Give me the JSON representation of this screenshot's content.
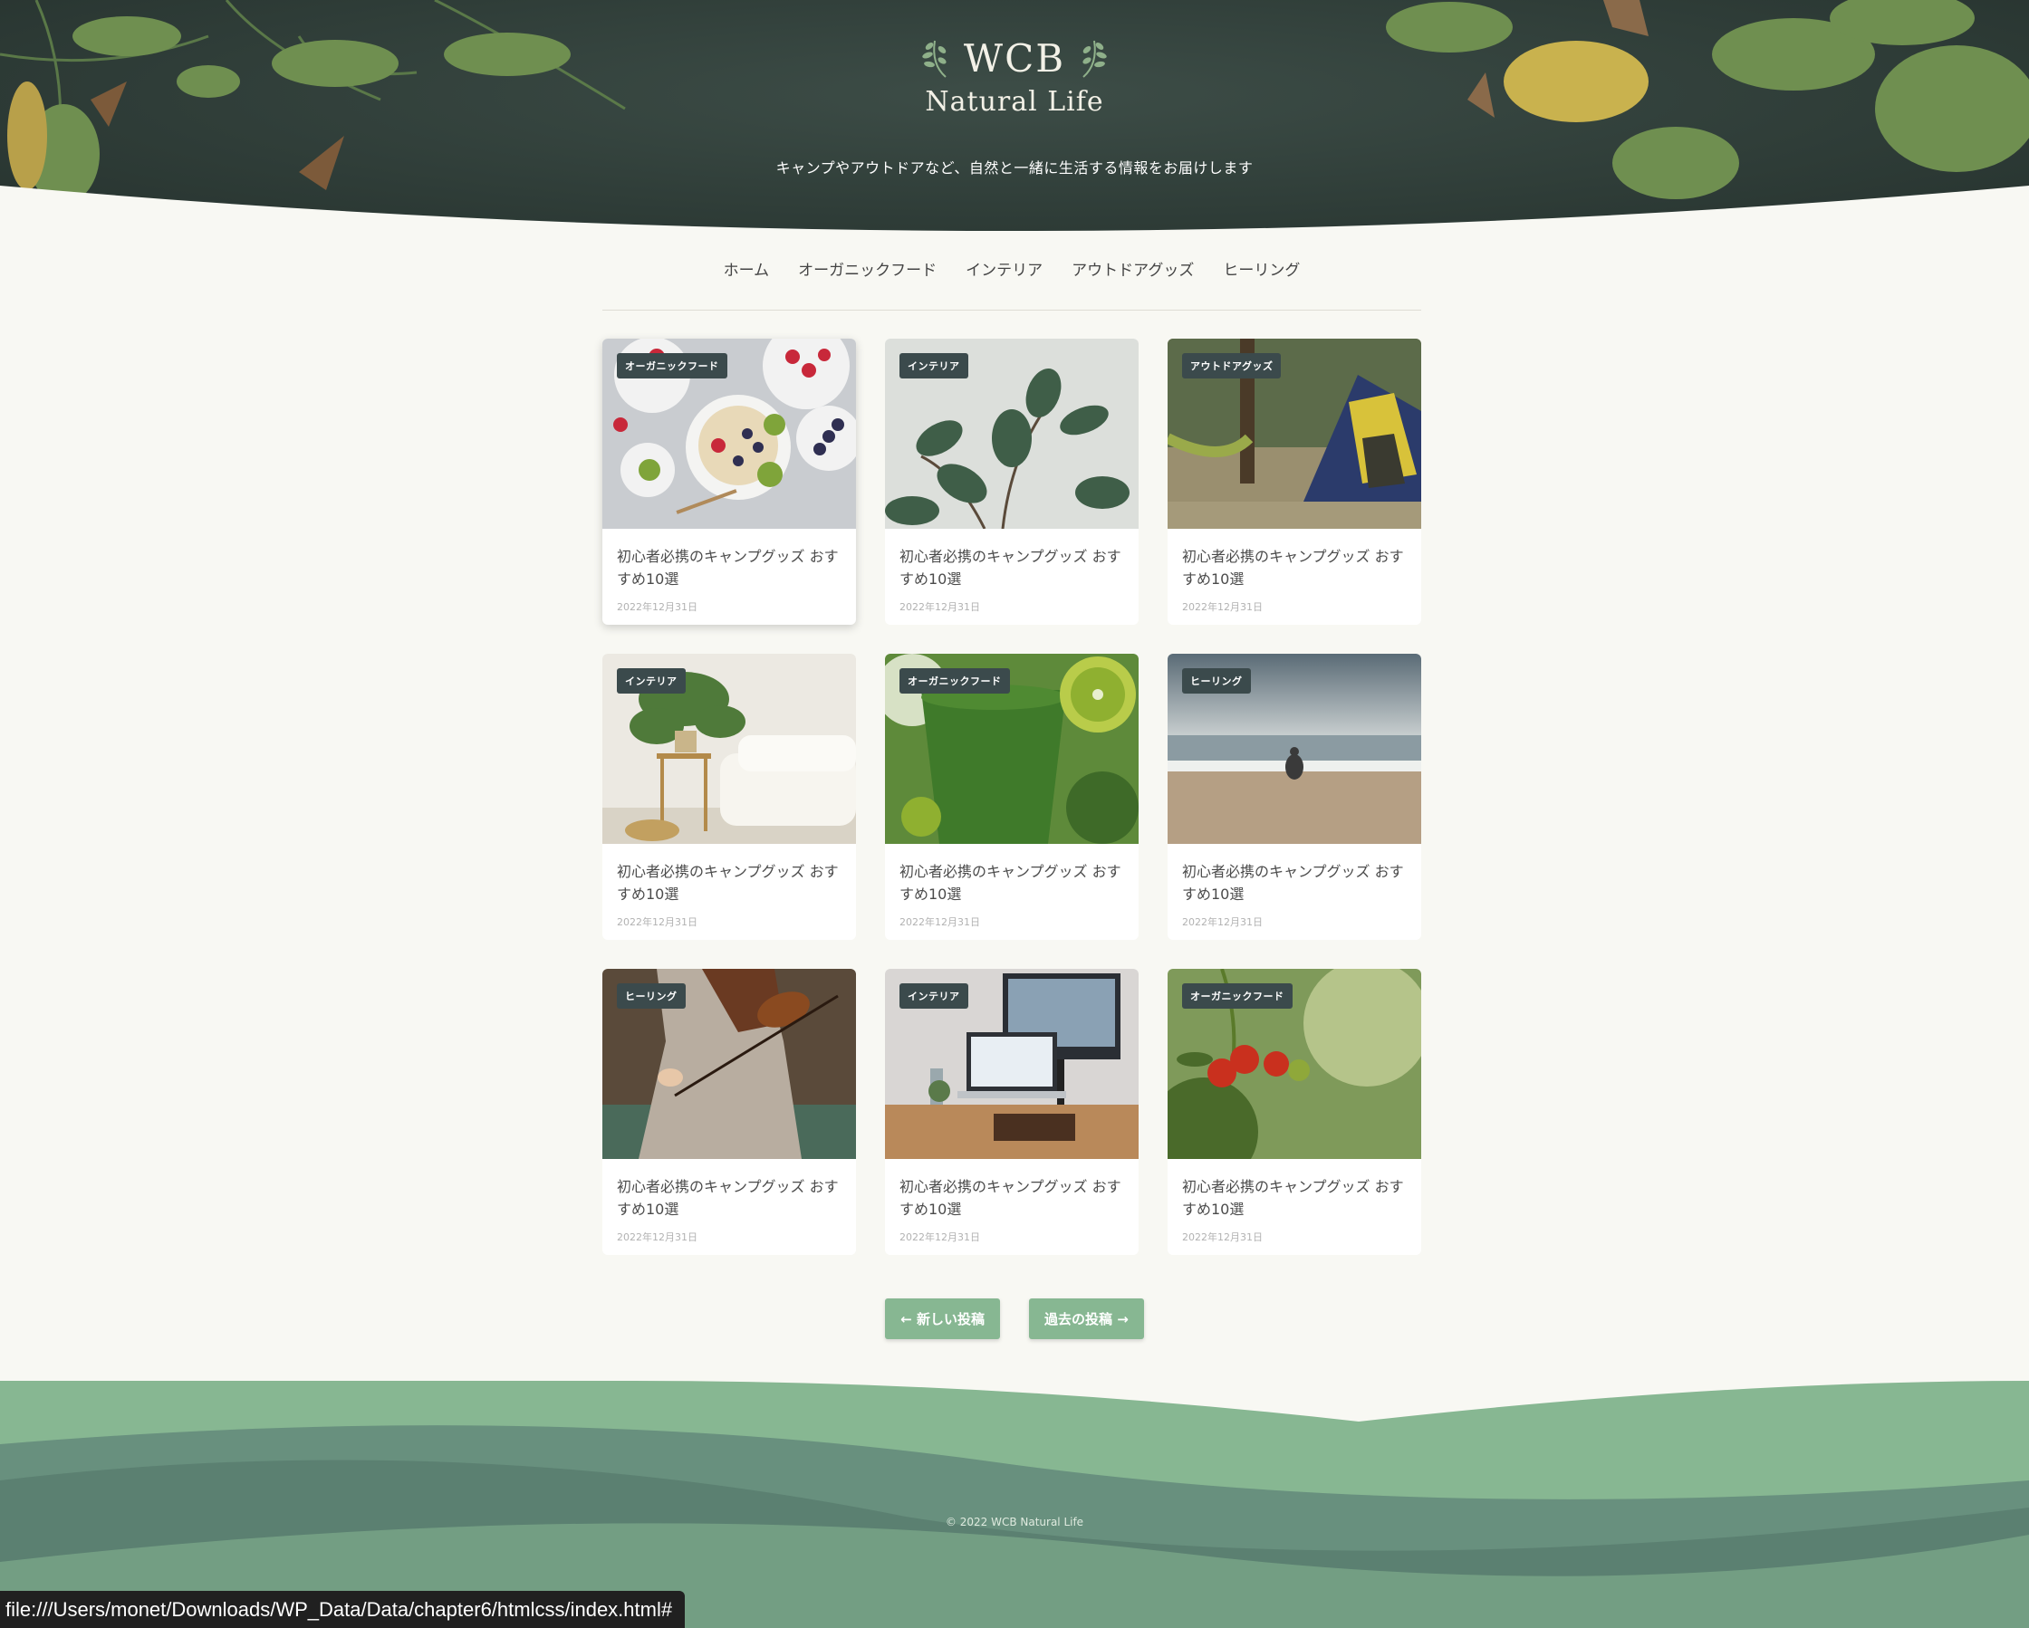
{
  "site": {
    "logo_main": "WCB",
    "logo_sub": "Natural Life",
    "tagline": "キャンプやアウトドアなど、自然と一緒に生活する情報をお届けします"
  },
  "nav": {
    "items": [
      {
        "label": "ホーム"
      },
      {
        "label": "オーガニックフード"
      },
      {
        "label": "インテリア"
      },
      {
        "label": "アウトドアグッズ"
      },
      {
        "label": "ヒーリング"
      }
    ]
  },
  "posts": [
    {
      "category": "オーガニックフード",
      "title": "初心者必携のキャンプグッズ おすすめ10選",
      "date": "2022年12月31日",
      "image": "fruit-bowls-photo"
    },
    {
      "category": "インテリア",
      "title": "初心者必携のキャンプグッズ おすすめ10選",
      "date": "2022年12月31日",
      "image": "houseplant-photo"
    },
    {
      "category": "アウトドアグッズ",
      "title": "初心者必携のキャンプグッズ おすすめ10選",
      "date": "2022年12月31日",
      "image": "tent-hammock-photo"
    },
    {
      "category": "インテリア",
      "title": "初心者必携のキャンプグッズ おすすめ10選",
      "date": "2022年12月31日",
      "image": "living-room-photo"
    },
    {
      "category": "オーガニックフード",
      "title": "初心者必携のキャンプグッズ おすすめ10選",
      "date": "2022年12月31日",
      "image": "green-smoothie-photo"
    },
    {
      "category": "ヒーリング",
      "title": "初心者必携のキャンプグッズ おすすめ10選",
      "date": "2022年12月31日",
      "image": "beach-meditation-photo"
    },
    {
      "category": "ヒーリング",
      "title": "初心者必携のキャンプグッズ おすすめ10選",
      "date": "2022年12月31日",
      "image": "violin-player-photo"
    },
    {
      "category": "インテリア",
      "title": "初心者必携のキャンプグッズ おすすめ10選",
      "date": "2022年12月31日",
      "image": "desk-computer-photo"
    },
    {
      "category": "オーガニックフード",
      "title": "初心者必携のキャンプグッズ おすすめ10選",
      "date": "2022年12月31日",
      "image": "tomato-plant-photo"
    }
  ],
  "pagination": {
    "newer_label": "← 新しい投稿",
    "older_label": "過去の投稿 →"
  },
  "footer": {
    "copyright": "© 2022 WCB Natural Life"
  },
  "status_bar": {
    "url": "file:///Users/monet/Downloads/WP_Data/Data/chapter6/htmlcss/index.html#"
  },
  "colors": {
    "background": "#f8f8f3",
    "header_dark": "#2f3d38",
    "badge": "#3b4a4c",
    "button": "#87b792",
    "footer_light": "#87b792",
    "footer_mid": "#68907e",
    "footer_dark": "#587a72"
  }
}
